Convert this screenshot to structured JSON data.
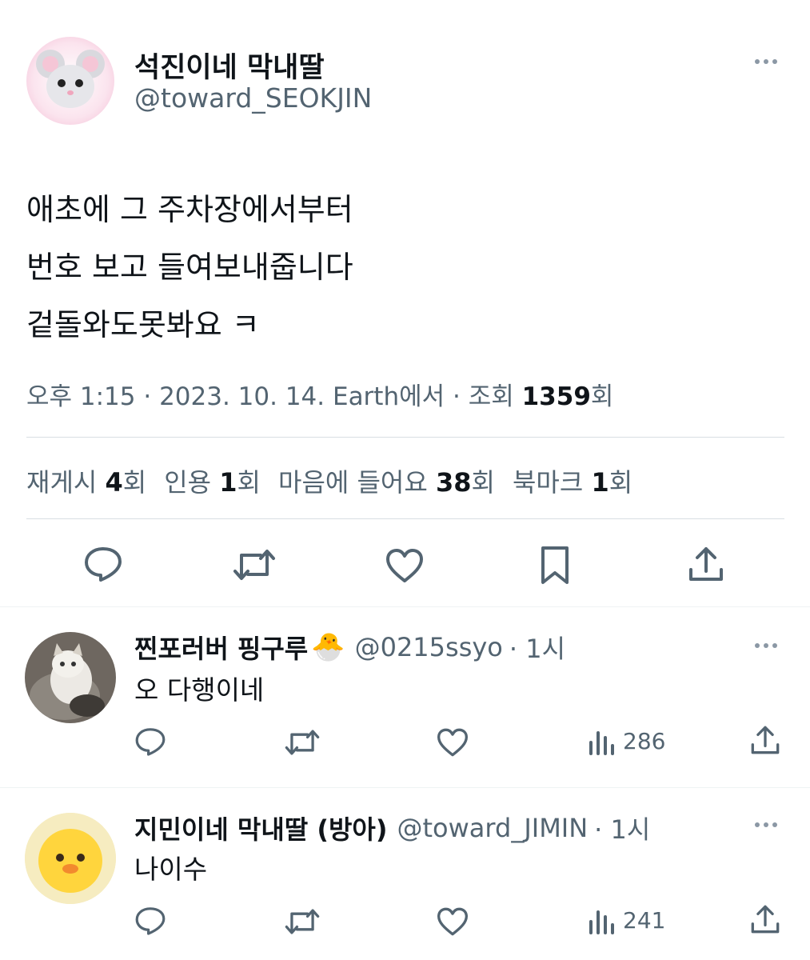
{
  "tweet": {
    "display_name": "석진이네 막내딸",
    "handle": "@toward_SEOKJIN",
    "lines": [
      "애초에 그 주차장에서부터",
      "번호 보고 들여보내줍니다",
      "겉돌와도못봐요 ㅋ"
    ],
    "meta_prefix": "오후 1:15 · 2023. 10. 14. Earth에서 · 조회 ",
    "views": "1359",
    "views_suffix": "회"
  },
  "stats": [
    {
      "label": "재게시 ",
      "value": "4",
      "suffix": "회"
    },
    {
      "label": "인용 ",
      "value": "1",
      "suffix": "회"
    },
    {
      "label": "마음에 들어요 ",
      "value": "38",
      "suffix": "회"
    },
    {
      "label": "북마크 ",
      "value": "1",
      "suffix": "회"
    }
  ],
  "replies": [
    {
      "display_name": "찐포러버 핑구루",
      "emoji": "🐣",
      "handle": "@0215ssyo",
      "time": "· 1시",
      "text": "오 다행이네",
      "views": "286"
    },
    {
      "display_name": "지민이네 막내딸 (방아)",
      "handle": "@toward_JIMIN",
      "time": "· 1시",
      "text": "나이수",
      "views": "241"
    }
  ],
  "icons": {
    "reply": "reply-icon",
    "retweet": "retweet-icon",
    "like": "heart-icon",
    "bookmark": "bookmark-icon",
    "share": "share-icon",
    "views": "views-icon",
    "more": "more-icon"
  },
  "colors": {
    "text_primary": "#0f1419",
    "text_secondary": "#536471",
    "divider": "#d9dee3"
  }
}
